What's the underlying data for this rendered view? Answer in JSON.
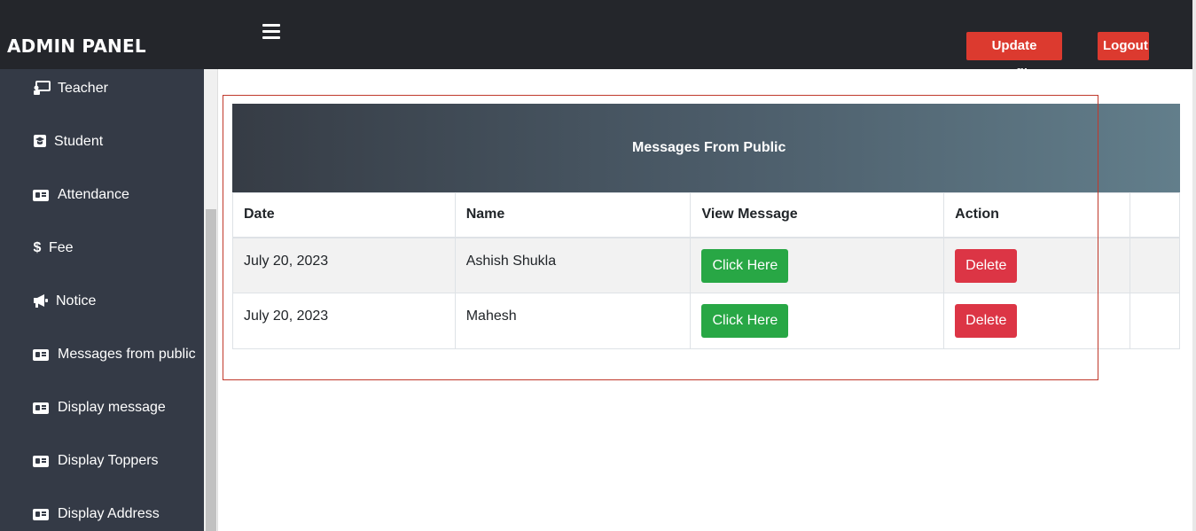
{
  "header": {
    "brand": "ADMIN PANEL",
    "update_profile": "Update Profile",
    "logout": "Logout"
  },
  "sidebar": {
    "items": [
      {
        "label": "Teacher",
        "icon": "teacher-board-icon"
      },
      {
        "label": "Student",
        "icon": "graduation-cap-icon"
      },
      {
        "label": "Attendance",
        "icon": "id-card-icon"
      },
      {
        "label": "Fee",
        "icon": "dollar-icon"
      },
      {
        "label": "Notice",
        "icon": "megaphone-icon"
      },
      {
        "label": "Messages from public",
        "icon": "id-card-icon"
      },
      {
        "label": "Display message",
        "icon": "id-card-icon"
      },
      {
        "label": "Display Toppers",
        "icon": "id-card-icon"
      },
      {
        "label": "Display Address",
        "icon": "id-card-icon"
      }
    ]
  },
  "panel": {
    "title": "Messages From Public",
    "columns": [
      "Date",
      "Name",
      "View Message",
      "Action"
    ],
    "rows": [
      {
        "date": "July 20, 2023",
        "name": "Ashish Shukla",
        "view": "Click Here",
        "action": "Delete"
      },
      {
        "date": "July 20, 2023",
        "name": "Mahesh",
        "view": "Click Here",
        "action": "Delete"
      }
    ]
  },
  "colors": {
    "topbar": "#24262b",
    "sidebar": "#343a46",
    "danger": "#dc3545",
    "success": "#28a745",
    "top_button": "#dc3a2f"
  }
}
